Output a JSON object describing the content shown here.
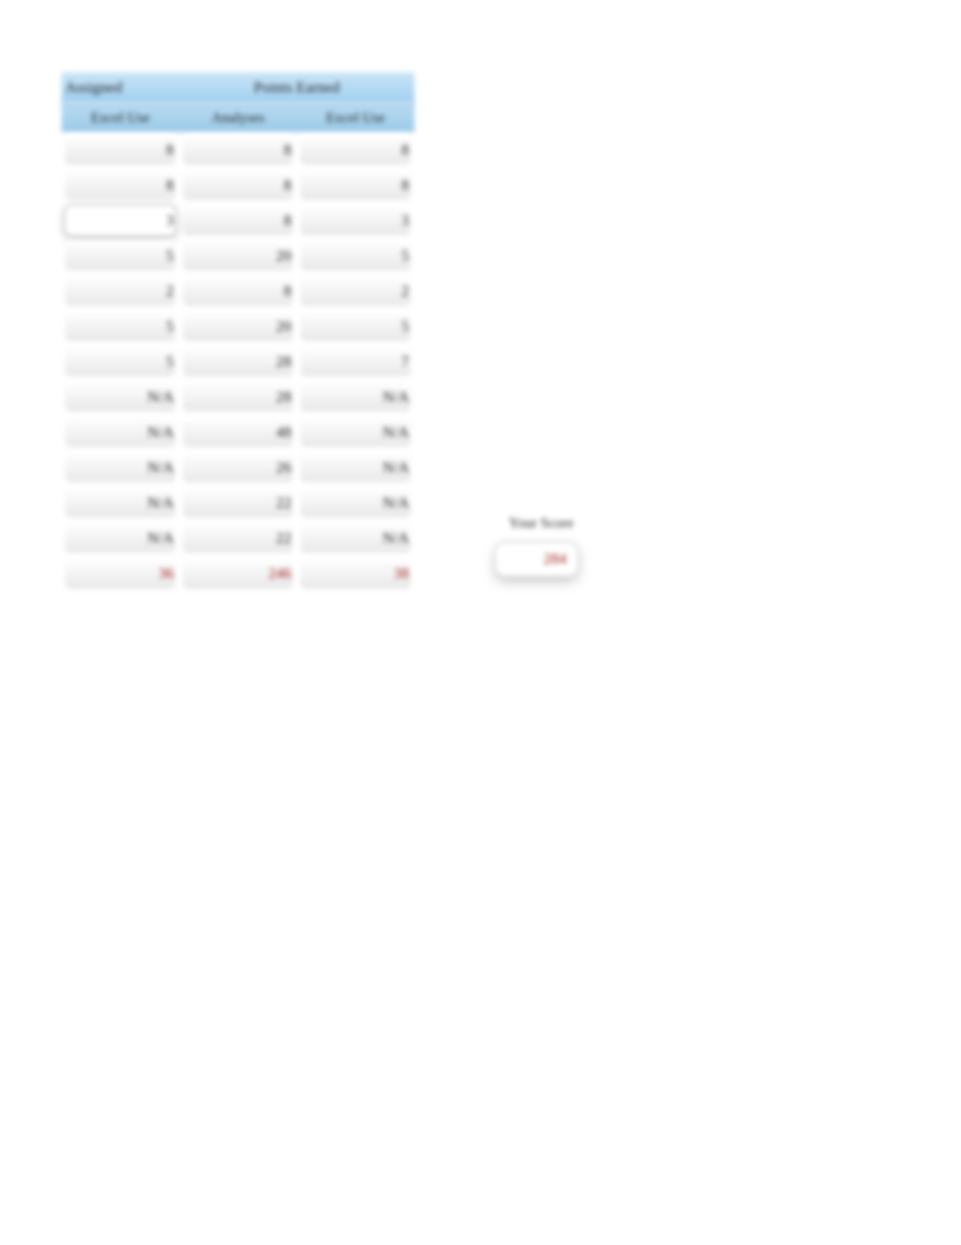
{
  "headers": {
    "assigned": "Assigned",
    "points_earned": "Points Earned",
    "sub": [
      "Excel Use",
      "Analyses",
      "Excel Use"
    ]
  },
  "rows": [
    {
      "c1": "8",
      "c2": "8",
      "c3": "8"
    },
    {
      "c1": "8",
      "c2": "8",
      "c3": "8"
    },
    {
      "c1": "3",
      "c2": "8",
      "c3": "3",
      "highlight_c1": true
    },
    {
      "c1": "5",
      "c2": "20",
      "c3": "5"
    },
    {
      "c1": "2",
      "c2": "8",
      "c3": "2"
    },
    {
      "c1": "5",
      "c2": "20",
      "c3": "5"
    },
    {
      "c1": "5",
      "c2": "28",
      "c3": "7"
    },
    {
      "c1": "N/A",
      "c2": "28",
      "c3": "N/A"
    },
    {
      "c1": "N/A",
      "c2": "48",
      "c3": "N/A"
    },
    {
      "c1": "N/A",
      "c2": "26",
      "c3": "N/A"
    },
    {
      "c1": "N/A",
      "c2": "22",
      "c3": "N/A"
    },
    {
      "c1": "N/A",
      "c2": "22",
      "c3": "N/A"
    }
  ],
  "totals": {
    "c1": "36",
    "c2": "246",
    "c3": "38"
  },
  "score": {
    "label": "Your Score",
    "value": "284"
  }
}
